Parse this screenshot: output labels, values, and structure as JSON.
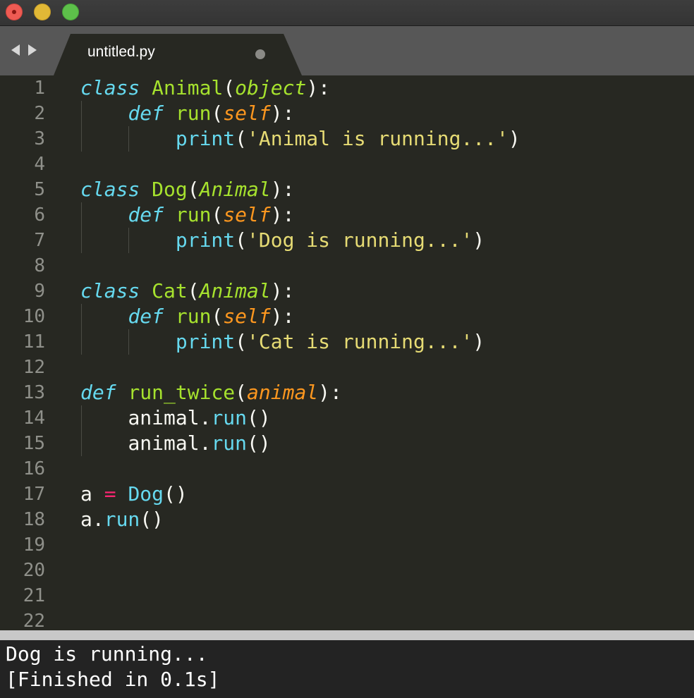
{
  "window": {
    "traffic_lights": {
      "close": "#ee5b53",
      "minimize": "#e1b836",
      "maximize": "#5dc04a"
    }
  },
  "tabs": [
    {
      "title": "untitled.py",
      "unsaved_indicator": true,
      "active": true
    }
  ],
  "navigation": {
    "back_icon": "triangle-left-icon",
    "forward_icon": "triangle-right-icon"
  },
  "editor": {
    "language": "python",
    "colors": {
      "keyword": "#66d9ef",
      "function": "#a6e22e",
      "parameter": "#fd971f",
      "string": "#e6db74",
      "operator": "#f92672",
      "text": "#f8f8f2"
    },
    "lines": [
      {
        "number": "1",
        "tokens": [
          {
            "t": "class",
            "c": "kw"
          },
          {
            "t": " ",
            "c": "pl"
          },
          {
            "t": "Animal",
            "c": "fn"
          },
          {
            "t": "(",
            "c": "pl"
          },
          {
            "t": "object",
            "c": "inh"
          },
          {
            "t": "):",
            "c": "pl"
          }
        ]
      },
      {
        "number": "2",
        "tokens": [
          {
            "t": "    ",
            "c": "pl"
          },
          {
            "t": "def",
            "c": "kw"
          },
          {
            "t": " ",
            "c": "pl"
          },
          {
            "t": "run",
            "c": "fn"
          },
          {
            "t": "(",
            "c": "pl"
          },
          {
            "t": "self",
            "c": "self"
          },
          {
            "t": "):",
            "c": "pl"
          }
        ]
      },
      {
        "number": "3",
        "tokens": [
          {
            "t": "        ",
            "c": "pl"
          },
          {
            "t": "print",
            "c": "bi"
          },
          {
            "t": "(",
            "c": "pl"
          },
          {
            "t": "'Animal is running...'",
            "c": "str"
          },
          {
            "t": ")",
            "c": "pl"
          }
        ]
      },
      {
        "number": "4",
        "tokens": []
      },
      {
        "number": "5",
        "tokens": [
          {
            "t": "class",
            "c": "kw"
          },
          {
            "t": " ",
            "c": "pl"
          },
          {
            "t": "Dog",
            "c": "fn"
          },
          {
            "t": "(",
            "c": "pl"
          },
          {
            "t": "Animal",
            "c": "inh"
          },
          {
            "t": "):",
            "c": "pl"
          }
        ]
      },
      {
        "number": "6",
        "tokens": [
          {
            "t": "    ",
            "c": "pl"
          },
          {
            "t": "def",
            "c": "kw"
          },
          {
            "t": " ",
            "c": "pl"
          },
          {
            "t": "run",
            "c": "fn"
          },
          {
            "t": "(",
            "c": "pl"
          },
          {
            "t": "self",
            "c": "self"
          },
          {
            "t": "):",
            "c": "pl"
          }
        ]
      },
      {
        "number": "7",
        "tokens": [
          {
            "t": "        ",
            "c": "pl"
          },
          {
            "t": "print",
            "c": "bi"
          },
          {
            "t": "(",
            "c": "pl"
          },
          {
            "t": "'Dog is running...'",
            "c": "str"
          },
          {
            "t": ")",
            "c": "pl"
          }
        ]
      },
      {
        "number": "8",
        "tokens": []
      },
      {
        "number": "9",
        "tokens": [
          {
            "t": "class",
            "c": "kw"
          },
          {
            "t": " ",
            "c": "pl"
          },
          {
            "t": "Cat",
            "c": "fn"
          },
          {
            "t": "(",
            "c": "pl"
          },
          {
            "t": "Animal",
            "c": "inh"
          },
          {
            "t": "):",
            "c": "pl"
          }
        ]
      },
      {
        "number": "10",
        "tokens": [
          {
            "t": "    ",
            "c": "pl"
          },
          {
            "t": "def",
            "c": "kw"
          },
          {
            "t": " ",
            "c": "pl"
          },
          {
            "t": "run",
            "c": "fn"
          },
          {
            "t": "(",
            "c": "pl"
          },
          {
            "t": "self",
            "c": "self"
          },
          {
            "t": "):",
            "c": "pl"
          }
        ]
      },
      {
        "number": "11",
        "tokens": [
          {
            "t": "        ",
            "c": "pl"
          },
          {
            "t": "print",
            "c": "bi"
          },
          {
            "t": "(",
            "c": "pl"
          },
          {
            "t": "'Cat is running...'",
            "c": "str"
          },
          {
            "t": ")",
            "c": "pl"
          }
        ]
      },
      {
        "number": "12",
        "tokens": []
      },
      {
        "number": "13",
        "tokens": [
          {
            "t": "def",
            "c": "kw"
          },
          {
            "t": " ",
            "c": "pl"
          },
          {
            "t": "run_twice",
            "c": "fn"
          },
          {
            "t": "(",
            "c": "pl"
          },
          {
            "t": "animal",
            "c": "self"
          },
          {
            "t": "):",
            "c": "pl"
          }
        ]
      },
      {
        "number": "14",
        "tokens": [
          {
            "t": "    ",
            "c": "pl"
          },
          {
            "t": "animal",
            "c": "pl"
          },
          {
            "t": ".",
            "c": "pl"
          },
          {
            "t": "run",
            "c": "bi"
          },
          {
            "t": "()",
            "c": "pl"
          }
        ]
      },
      {
        "number": "15",
        "tokens": [
          {
            "t": "    ",
            "c": "pl"
          },
          {
            "t": "animal",
            "c": "pl"
          },
          {
            "t": ".",
            "c": "pl"
          },
          {
            "t": "run",
            "c": "bi"
          },
          {
            "t": "()",
            "c": "pl"
          }
        ]
      },
      {
        "number": "16",
        "tokens": []
      },
      {
        "number": "17",
        "tokens": [
          {
            "t": "a",
            "c": "pl"
          },
          {
            "t": " ",
            "c": "pl"
          },
          {
            "t": "=",
            "c": "op"
          },
          {
            "t": " ",
            "c": "pl"
          },
          {
            "t": "Dog",
            "c": "bi"
          },
          {
            "t": "()",
            "c": "pl"
          }
        ]
      },
      {
        "number": "18",
        "tokens": [
          {
            "t": "a",
            "c": "pl"
          },
          {
            "t": ".",
            "c": "pl"
          },
          {
            "t": "run",
            "c": "bi"
          },
          {
            "t": "()",
            "c": "pl"
          }
        ]
      },
      {
        "number": "19",
        "tokens": []
      },
      {
        "number": "20",
        "tokens": []
      },
      {
        "number": "21",
        "tokens": []
      },
      {
        "number": "22",
        "tokens": []
      }
    ]
  },
  "output_panel": {
    "lines": [
      "Dog is running...",
      "[Finished in 0.1s]"
    ]
  }
}
